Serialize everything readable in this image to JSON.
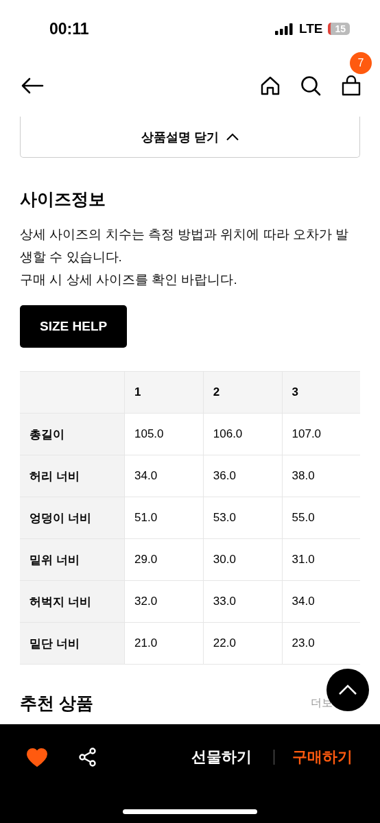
{
  "status_bar": {
    "time": "00:11",
    "network": "LTE",
    "battery": "15"
  },
  "header": {
    "cart_count": "7"
  },
  "collapse_button": {
    "label": "상품설명 닫기"
  },
  "size_info": {
    "title": "사이즈정보",
    "description": [
      "상세 사이즈의 치수는 측정 방법과 위치에 따라 오차가 발생할 수 있습니다.",
      "구매 시 상세 사이즈를 확인 바랍니다."
    ],
    "help_button": "SIZE HELP"
  },
  "size_table": {
    "columns": [
      "",
      "1",
      "2",
      "3"
    ],
    "rows": [
      [
        "총길이",
        "105.0",
        "106.0",
        "107.0"
      ],
      [
        "허리 너비",
        "34.0",
        "36.0",
        "38.0"
      ],
      [
        "엉덩이 너비",
        "51.0",
        "53.0",
        "55.0"
      ],
      [
        "밑위 너비",
        "29.0",
        "30.0",
        "31.0"
      ],
      [
        "허벅지 너비",
        "32.0",
        "33.0",
        "34.0"
      ],
      [
        "밑단 너비",
        "21.0",
        "22.0",
        "23.0"
      ]
    ]
  },
  "recommended": {
    "title": "추천 상품",
    "more_link": "더보"
  },
  "bottom_bar": {
    "liked": true,
    "gift_button": "선물하기",
    "buy_button": "구매하기"
  }
}
